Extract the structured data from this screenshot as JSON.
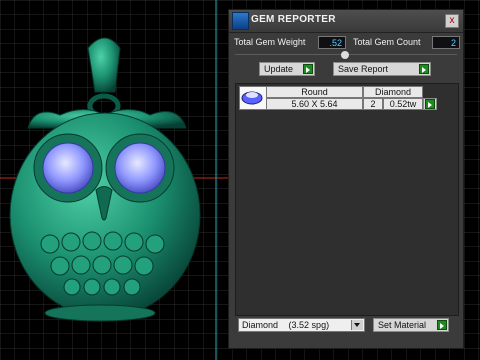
{
  "panel": {
    "title": "GEM REPORTER",
    "total_gem_weight_label": "Total Gem Weight",
    "total_gem_weight_value": ".52",
    "total_gem_count_label": "Total Gem Count",
    "total_gem_count_value": "2",
    "update_label": "Update",
    "save_report_label": "Save Report",
    "close_glyph": "x"
  },
  "gem_table": {
    "headers": [
      "Round",
      "Diamond"
    ],
    "rows": [
      {
        "size": "5.60 X 5.64",
        "count": "2",
        "weight": "0.52tw"
      }
    ]
  },
  "material": {
    "selected": "Diamond",
    "spg": "(3.52 spg)",
    "set_material_label": "Set Material"
  },
  "colors": {
    "accent": "#1f8a1f",
    "value_text": "#5ad1ff",
    "owl_body": "#1d8f6d"
  }
}
